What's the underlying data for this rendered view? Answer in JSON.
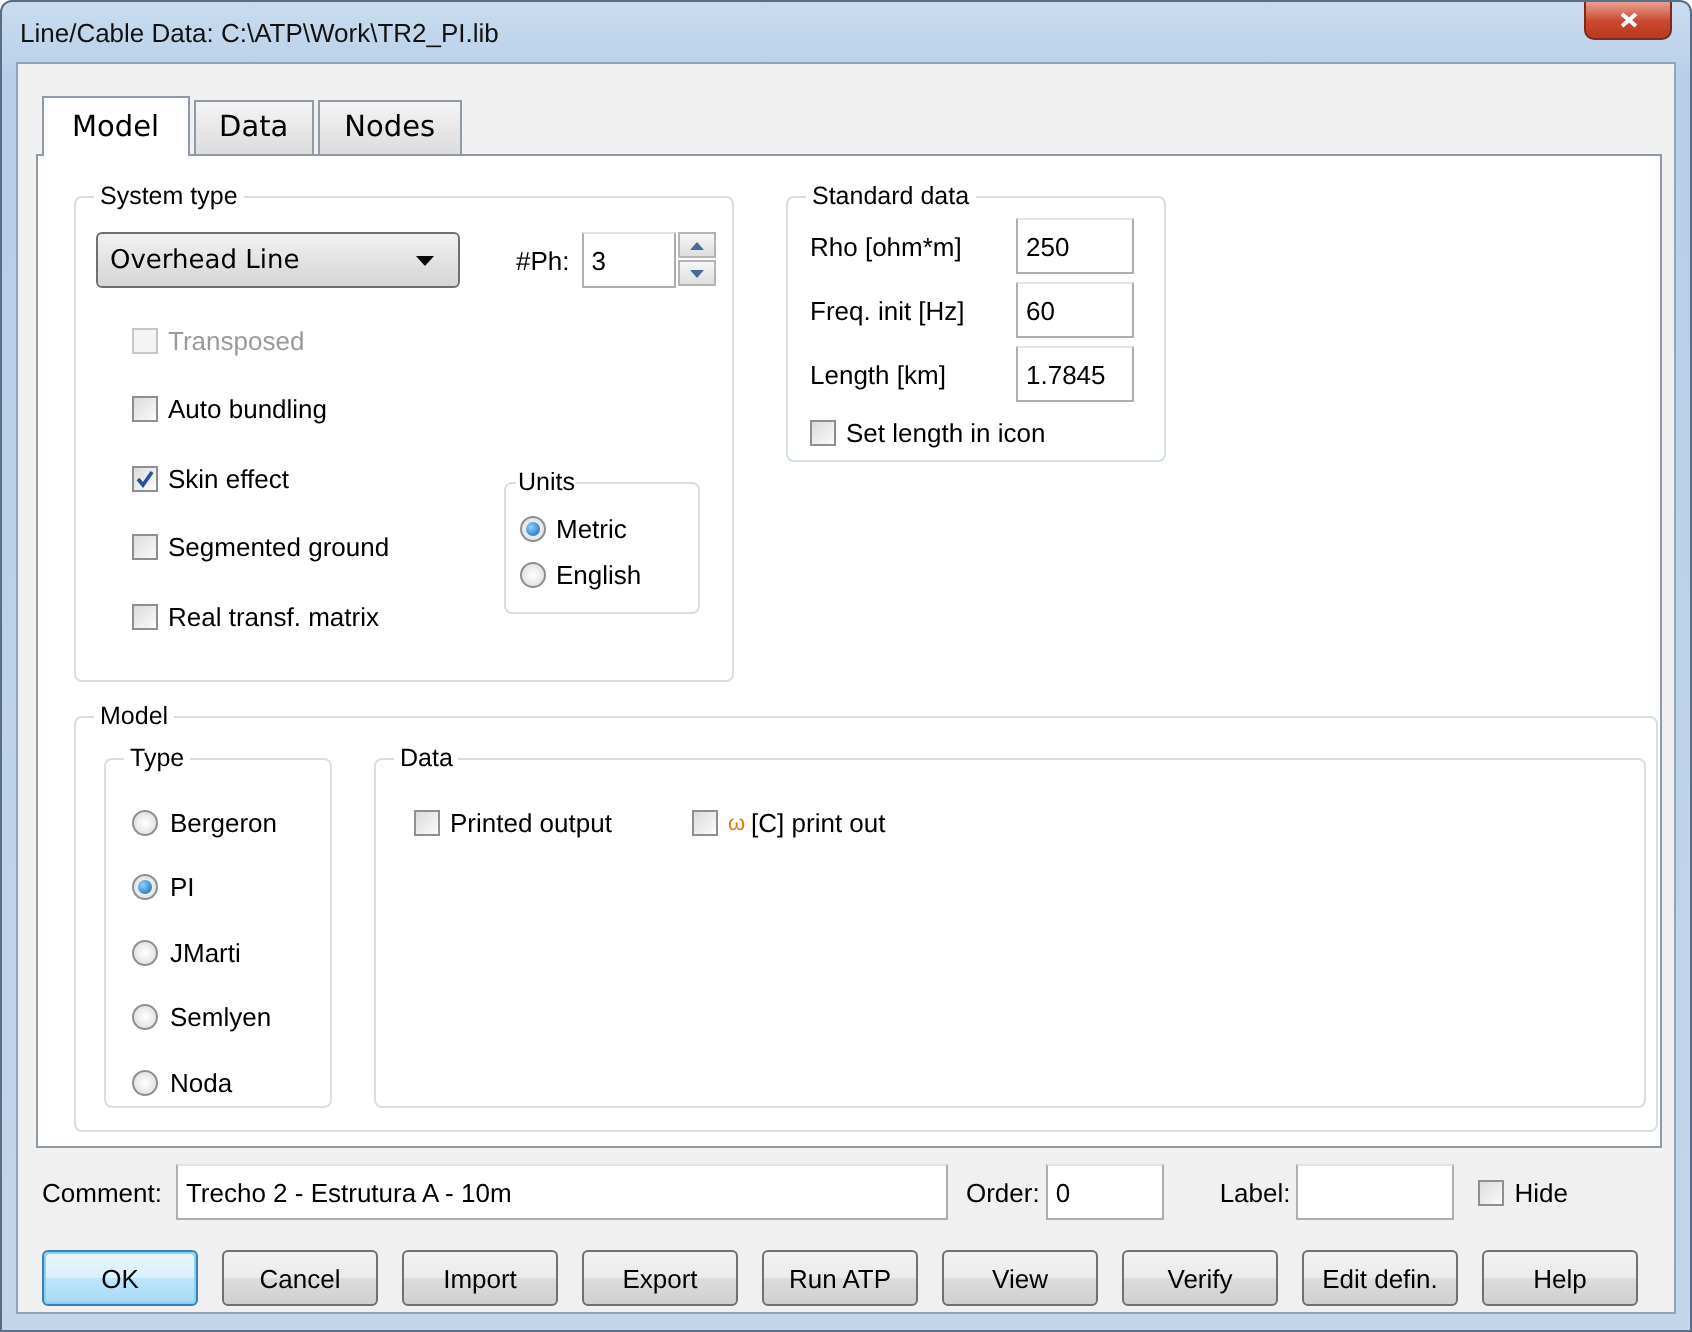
{
  "window": {
    "title": "Line/Cable Data: C:\\ATP\\Work\\TR2_PI.lib"
  },
  "tabs": [
    {
      "label": "Model",
      "selected": true
    },
    {
      "label": "Data",
      "selected": false
    },
    {
      "label": "Nodes",
      "selected": false
    }
  ],
  "system_type": {
    "title": "System type",
    "dropdown": "Overhead Line",
    "phases": {
      "label": "#Ph:",
      "value": "3"
    },
    "options": [
      {
        "label": "Transposed",
        "checked": false,
        "disabled": true
      },
      {
        "label": "Auto bundling",
        "checked": false,
        "disabled": false
      },
      {
        "label": "Skin effect",
        "checked": true,
        "disabled": false
      },
      {
        "label": "Segmented ground",
        "checked": false,
        "disabled": false
      },
      {
        "label": "Real transf. matrix",
        "checked": false,
        "disabled": false
      }
    ],
    "units": {
      "title": "Units",
      "options": [
        {
          "label": "Metric",
          "selected": true
        },
        {
          "label": "English",
          "selected": false
        }
      ]
    }
  },
  "standard_data": {
    "title": "Standard data",
    "fields": [
      {
        "label": "Rho [ohm*m]",
        "value": "250"
      },
      {
        "label": "Freq. init [Hz]",
        "value": "60"
      },
      {
        "label": "Length [km]",
        "value": "1.7845"
      }
    ],
    "set_length": {
      "label": "Set length in icon",
      "checked": false
    }
  },
  "model": {
    "title": "Model",
    "type": {
      "title": "Type",
      "options": [
        {
          "label": "Bergeron",
          "selected": false
        },
        {
          "label": "PI",
          "selected": true
        },
        {
          "label": "JMarti",
          "selected": false
        },
        {
          "label": "Semlyen",
          "selected": false
        },
        {
          "label": "Noda",
          "selected": false
        }
      ]
    },
    "data": {
      "title": "Data",
      "options": [
        {
          "label": "Printed output",
          "checked": false
        },
        {
          "symbol": "ω",
          "label": "[C] print out",
          "checked": false
        }
      ]
    }
  },
  "comment": {
    "label": "Comment:",
    "value": "Trecho 2 - Estrutura A - 10m"
  },
  "order": {
    "label": "Order:",
    "value": "0"
  },
  "node_label": {
    "label": "Label:"
  },
  "hide": {
    "label": "Hide",
    "checked": false
  },
  "buttons": [
    {
      "label": "OK",
      "default": true
    },
    {
      "label": "Cancel",
      "default": false
    },
    {
      "label": "Import",
      "default": false
    },
    {
      "label": "Export",
      "default": false
    },
    {
      "label": "Run ATP",
      "default": false
    },
    {
      "label": "View",
      "default": false
    },
    {
      "label": "Verify",
      "default": false
    },
    {
      "label": "Edit defin.",
      "default": false
    },
    {
      "label": "Help",
      "default": false
    }
  ]
}
